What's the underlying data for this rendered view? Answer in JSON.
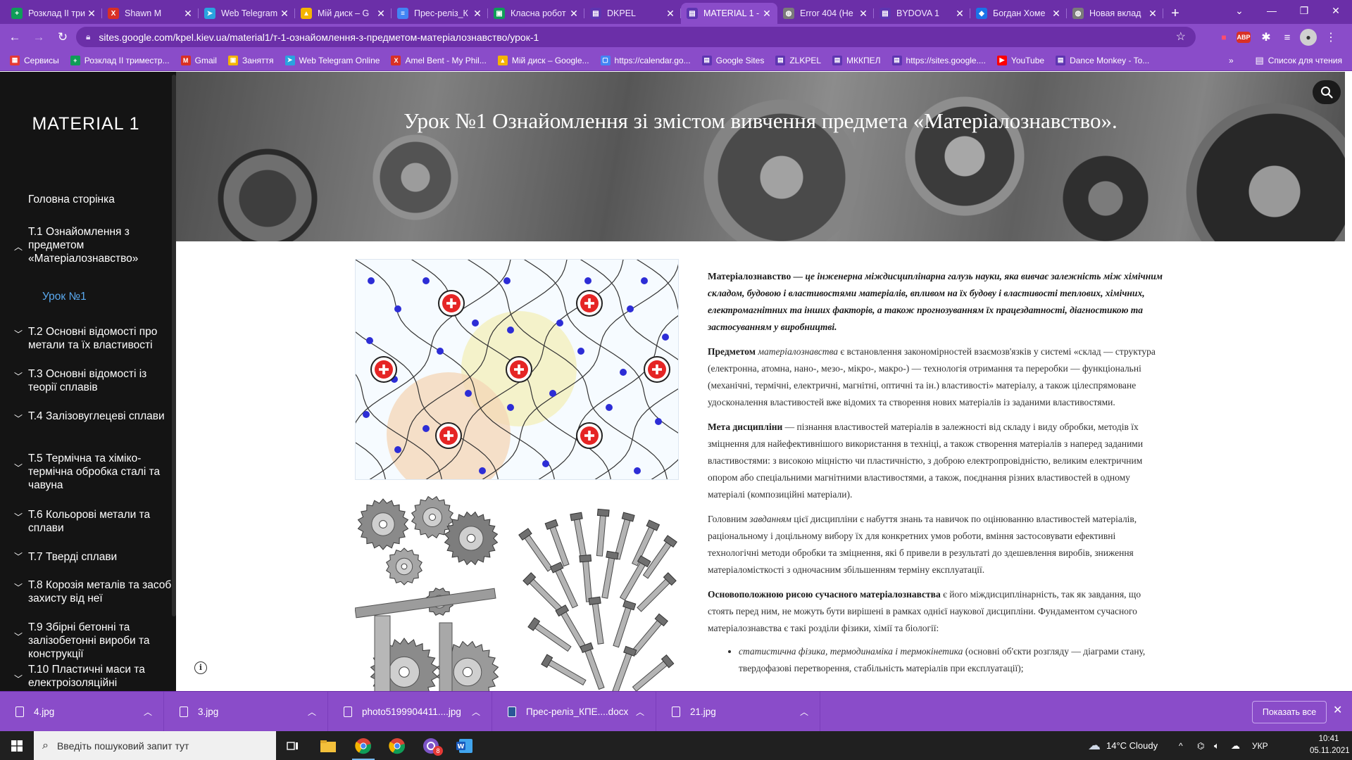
{
  "browser": {
    "tabs": [
      {
        "title": "Розклад ІІ три",
        "icon": "sheets-icon",
        "color": "#0f9d58",
        "glyph": "+"
      },
      {
        "title": "Shawn M",
        "icon": "x-icon",
        "color": "#d93025",
        "glyph": "X"
      },
      {
        "title": "Web Telegram",
        "icon": "telegram-icon",
        "color": "#2aa3df",
        "glyph": "➤"
      },
      {
        "title": "Мій диск – G",
        "icon": "drive-icon",
        "color": "#f4b400",
        "glyph": "▲"
      },
      {
        "title": "Прес-реліз_К",
        "icon": "docs-icon",
        "color": "#4285f4",
        "glyph": "≡"
      },
      {
        "title": "Класна робот",
        "icon": "classroom-icon",
        "color": "#0f9d58",
        "glyph": "▣"
      },
      {
        "title": "DKPEL",
        "icon": "sites-icon",
        "color": "#5e35b1",
        "glyph": "▤"
      },
      {
        "title": "MATERIAL 1 -",
        "icon": "sites-icon",
        "color": "#5e35b1",
        "glyph": "▤"
      },
      {
        "title": "Error 404 (Не",
        "icon": "globe-icon",
        "color": "#7a7a7a",
        "glyph": "◍"
      },
      {
        "title": "BYDOVA 1",
        "icon": "sites-icon",
        "color": "#5e35b1",
        "glyph": "▤"
      },
      {
        "title": "Богдан Хоме",
        "icon": "brand-icon",
        "color": "#1a73e8",
        "glyph": "◆"
      },
      {
        "title": "Новая вклад",
        "icon": "globe-icon",
        "color": "#7a7a7a",
        "glyph": "◍"
      }
    ],
    "active_tab": 7,
    "url": "sites.google.com/kpel.kiev.ua/material1/т-1-ознайомлення-з-предметом-матеріалознавство/урок-1",
    "bookmarks": [
      {
        "label": "Сервисы",
        "icon": "apps-icon",
        "color": "#e53935",
        "glyph": "▦"
      },
      {
        "label": "Розклад ІІ триместр...",
        "icon": "sheets-icon",
        "color": "#0f9d58",
        "glyph": "+"
      },
      {
        "label": "Gmail",
        "icon": "gmail-icon",
        "color": "#d93025",
        "glyph": "M"
      },
      {
        "label": "Заняття",
        "icon": "classroom-icon",
        "color": "#f4b400",
        "glyph": "▣"
      },
      {
        "label": "Web Telegram Online",
        "icon": "telegram-icon",
        "color": "#2aa3df",
        "glyph": "➤"
      },
      {
        "label": "Amel Bent - My Phil...",
        "icon": "x-icon",
        "color": "#d93025",
        "glyph": "X"
      },
      {
        "label": "Мій диск – Google...",
        "icon": "drive-icon",
        "color": "#f4b400",
        "glyph": "▲"
      },
      {
        "label": "https://calendar.go...",
        "icon": "calendar-icon",
        "color": "#4285f4",
        "glyph": "▢"
      },
      {
        "label": "Google Sites",
        "icon": "sites-icon",
        "color": "#5e35b1",
        "glyph": "▤"
      },
      {
        "label": "ZLKPEL",
        "icon": "sites-icon",
        "color": "#5e35b1",
        "glyph": "▤"
      },
      {
        "label": "МККПЕЛ",
        "icon": "sites-icon",
        "color": "#5e35b1",
        "glyph": "▤"
      },
      {
        "label": "https://sites.google....",
        "icon": "sites-icon",
        "color": "#5e35b1",
        "glyph": "▤"
      },
      {
        "label": "YouTube",
        "icon": "youtube-icon",
        "color": "#ff0000",
        "glyph": "▶"
      },
      {
        "label": "Dance Monkey - To...",
        "icon": "sites-icon",
        "color": "#5e35b1",
        "glyph": "▤"
      }
    ],
    "bookmarks_more": "»",
    "reading_list": "Список для чтения"
  },
  "site": {
    "title": "MATERIAL 1",
    "nav": [
      {
        "label": "Головна сторінка",
        "chevron": ""
      },
      {
        "label": "Т.1 Ознайомлення з предметом «Матеріалознавство»",
        "chevron": "^"
      },
      {
        "label": "Урок №1",
        "chevron": ""
      },
      {
        "label": "Т.2 Основні відомості про метали та їх властивості",
        "chevron": "v"
      },
      {
        "label": "Т.3 Основні відомості із теорії сплавів",
        "chevron": "v"
      },
      {
        "label": "Т.4 Залізовуглецеві сплави",
        "chevron": "v"
      },
      {
        "label": "Т.5 Термічна та хіміко-термічна обробка сталі та чавуна",
        "chevron": "v"
      },
      {
        "label": "Т.6 Кольорові метали та сплави",
        "chevron": "v"
      },
      {
        "label": "Т.7 Тверді сплави",
        "chevron": "v"
      },
      {
        "label": "Т.8 Корозія металів та засоби захисту від неї",
        "chevron": "v"
      },
      {
        "label": "Т.9 Збірні бетонні та залізобетонні вироби та конструкції",
        "chevron": "v"
      },
      {
        "label": "Т.10 Пластичні маси та електроізоляційні",
        "chevron": "v"
      }
    ],
    "page_heading": "Урок №1 Ознайомлення зі змістом вивчення предмета «Матеріалознавство».",
    "paragraphs": {
      "p1_bold": "Матеріалознавство",
      "p1_rest": " — це інженерна міждисциплінарна галузь науки, яка вивчає залежність між хімічним складом, будовою і властивостями матеріалів, впливом на їх будову і властивості теплових, хімічних, електромагнітних та інших факторів, а також прогнозуванням їх працездатності, діагностикою та застосуванням у виробництві.",
      "p2_bold": "Предметом",
      "p2_ital": " матеріалознавства",
      "p2_rest": " є встановлення закономірностей взаємозв'язків у системі «склад — структура (електронна, атомна, нано-, мезо-, мікро-, макро-) — технологія отримання та переробки — функціональні (механічні, термічні, електричні, магнітні, оптичні та ін.) властивості» матеріалу, а також цілеспрямоване удосконалення властивостей вже відомих та створення нових матеріалів із заданими властивостями.",
      "p3_bold": "Мета дисципліни",
      "p3_rest": " — пізнання властивостей матеріалів в залежності від складу і виду обробки, методів їх зміцнення для найефективнішого використання в техніці, а також створення матеріалів з наперед заданими властивостями: з високою міцністю чи пластичністю, з доброю електропровідністю, великим електричним опором або спеціальними магнітними властивостями, а також, поєднання різних властивостей в одному матеріалі (композиційні матеріали).",
      "p4_start": "Головним ",
      "p4_ital": "завданням",
      "p4_rest": " цієї дисципліни є набуття знань та навичок по оцінюванню властивостей матеріалів, раціональному і доцільному вибору їх для конкретних умов роботи, вміння застосовувати ефективні технологічні методи обробки та зміцнення, які б привели в результаті до здешевлення виробів, зниження матеріаломісткості з одночасним збільшенням терміну експлуатації.",
      "p5_bold": "Основоположною рисою сучасного матеріалознавства",
      "p5_rest": " є його міждисциплінарність, так як завдання, що стоять перед ним, не можуть бути вирішені в рамках однієї наукової дисципліни. Фундаментом сучасного матеріалознавства є такі розділи фізики, хімії та біології:",
      "li1_ital": "статистична фізика, термодинаміка і термокінетика",
      "li1_rest": " (основні об'єкти розгляду — діаграми стану, твердофазові перетворення, стабільність матеріалів при експлуатації);"
    }
  },
  "downloads": {
    "items": [
      {
        "name": "4.jpg",
        "kind": "image"
      },
      {
        "name": "3.jpg",
        "kind": "image"
      },
      {
        "name": "photo5199904411....jpg",
        "kind": "image"
      },
      {
        "name": "Прес-реліз_КПЕ....docx",
        "kind": "word"
      },
      {
        "name": "21.jpg",
        "kind": "image"
      }
    ],
    "show_all": "Показать все"
  },
  "taskbar": {
    "search_placeholder": "Введіть пошуковий запит тут",
    "weather": "14°C  Cloudy",
    "language": "УКР",
    "time": "10:41",
    "date": "05.11.2021",
    "telegram_badge": "8"
  }
}
